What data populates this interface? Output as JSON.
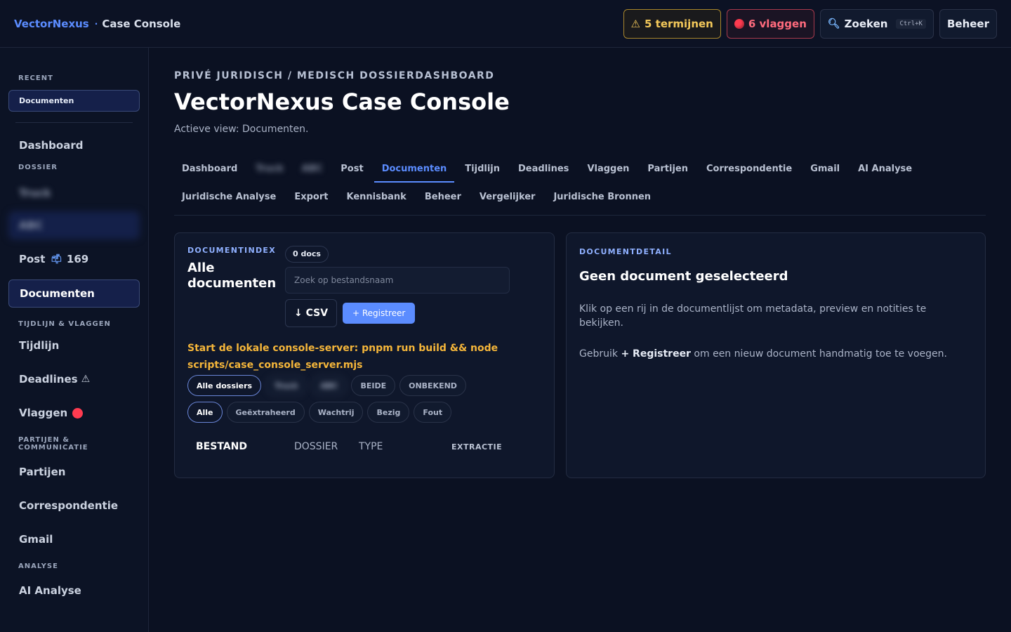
{
  "header": {
    "brand": "VectorNexus",
    "separator": "·",
    "subtitle": "Case Console",
    "deadlines_badge": "5 termijnen",
    "flags_badge": "6 vlaggen",
    "search_label": "Zoeken",
    "search_shortcut": "Ctrl+K",
    "admin_label": "Beheer"
  },
  "sidebar": {
    "recent_heading": "RECENT",
    "recent_item": "Documenten",
    "dashboard": "Dashboard",
    "dossier_heading": "DOSSIER",
    "blur_item_1": "Truck",
    "blur_item_2": "ABC",
    "post": "Post",
    "post_count": "169",
    "documents": "Documenten",
    "timeline_heading": "TIJDLIJN & VLAGGEN",
    "timeline": "Tijdlijn",
    "deadlines": "Deadlines",
    "flags": "Vlaggen",
    "parties_heading": "PARTIJEN & COMMUNICATIE",
    "parties": "Partijen",
    "correspondence": "Correspondentie",
    "gmail": "Gmail",
    "analysis_heading": "ANALYSE",
    "ai_analysis": "AI Analyse"
  },
  "main": {
    "eyebrow": "PRIVÉ JURIDISCH / MEDISCH DOSSIERDASHBOARD",
    "title": "VectorNexus Case Console",
    "subtitle": "Actieve view: Documenten.",
    "tabs": [
      "Dashboard",
      "Truck",
      "ABC",
      "Post",
      "Documenten",
      "Tijdlijn",
      "Deadlines",
      "Vlaggen",
      "Partijen",
      "Correspondentie",
      "Gmail",
      "AI Analyse",
      "Juridische Analyse",
      "Export",
      "Kennisbank",
      "Beheer",
      "Vergelijker",
      "Juridische Bronnen"
    ]
  },
  "doc_index": {
    "label": "DOCUMENTINDEX",
    "title_line1": "Alle",
    "title_line2": "documenten",
    "count": "0 docs",
    "search_placeholder": "Zoek op bestandsnaam",
    "csv_label": "↓ CSV",
    "register_label": "+ Registreer",
    "server_message": "Start de lokale console-server: pnpm run build && node scripts/case_console_server.mjs",
    "dossier_filters": [
      "Alle dossiers",
      "Truck",
      "ABC",
      "BEIDE",
      "ONBEKEND"
    ],
    "status_filters": [
      "Alle",
      "Geëxtraheerd",
      "Wachtrij",
      "Bezig",
      "Fout"
    ],
    "columns": [
      "BESTAND",
      "DOSSIER",
      "TYPE",
      "EXTRACTIE"
    ]
  },
  "doc_detail": {
    "label": "DOCUMENTDETAIL",
    "title": "Geen document geselecteerd",
    "text1": "Klik op een rij in de documentlijst om metadata, preview en notities te bekijken.",
    "text2_prefix": "Gebruik",
    "text2_bold": "+ Registreer",
    "text2_suffix": "om een nieuw document handmatig toe te voegen."
  }
}
